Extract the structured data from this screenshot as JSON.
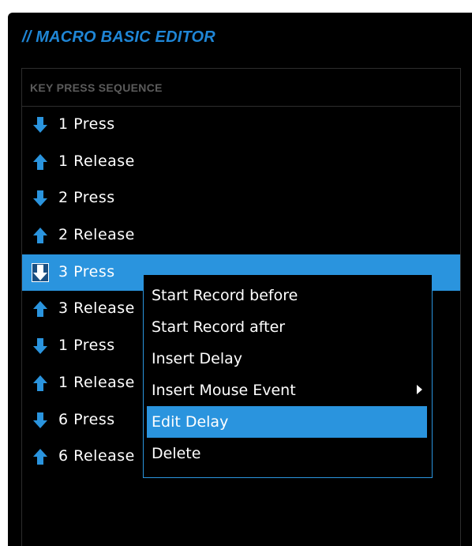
{
  "panel": {
    "title": "// MACRO BASIC EDITOR"
  },
  "sequence": {
    "header": "KEY PRESS SEQUENCE",
    "rows": [
      {
        "icon": "arrow-down-icon",
        "label": "1 Press",
        "selected": false
      },
      {
        "icon": "arrow-up-icon",
        "label": "1 Release",
        "selected": false
      },
      {
        "icon": "arrow-down-icon",
        "label": "2 Press",
        "selected": false
      },
      {
        "icon": "arrow-up-icon",
        "label": "2 Release",
        "selected": false
      },
      {
        "icon": "arrow-down-icon",
        "label": "3 Press",
        "selected": true
      },
      {
        "icon": "arrow-up-icon",
        "label": "3 Release",
        "selected": false
      },
      {
        "icon": "arrow-down-icon",
        "label": "1 Press",
        "selected": false
      },
      {
        "icon": "arrow-up-icon",
        "label": "1 Release",
        "selected": false
      },
      {
        "icon": "arrow-down-icon",
        "label": "6 Press",
        "selected": false
      },
      {
        "icon": "arrow-up-icon",
        "label": "6 Release",
        "selected": false
      }
    ]
  },
  "context_menu": {
    "items": [
      {
        "label": "Start Record before",
        "active": false,
        "submenu": false
      },
      {
        "label": "Start Record after",
        "active": false,
        "submenu": false
      },
      {
        "label": "Insert Delay",
        "active": false,
        "submenu": false
      },
      {
        "label": "Insert Mouse Event",
        "active": false,
        "submenu": true
      },
      {
        "label": "Edit Delay",
        "active": true,
        "submenu": false
      },
      {
        "label": "Delete",
        "active": false,
        "submenu": false
      }
    ]
  },
  "colors": {
    "accent": "#2a94de",
    "title": "#1f86d6",
    "header_text": "#5b5b5b",
    "background": "#000000"
  }
}
